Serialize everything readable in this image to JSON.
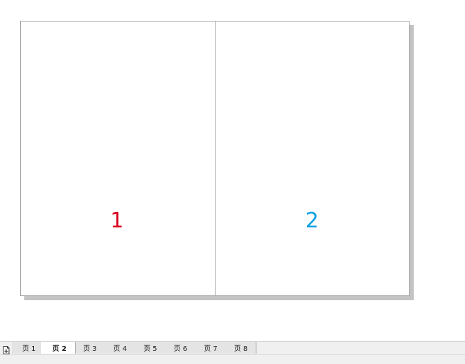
{
  "document": {
    "pages": [
      {
        "label": "1",
        "color": "#d9001b"
      },
      {
        "label": "2",
        "color": "#0ea0e4"
      }
    ]
  },
  "tabbar": {
    "add_icon": "add-page-icon",
    "tabs": [
      {
        "label": "页 1",
        "active": false
      },
      {
        "label": "页 2",
        "active": true
      },
      {
        "label": "页 3",
        "active": false
      },
      {
        "label": "页 4",
        "active": false
      },
      {
        "label": "页 5",
        "active": false
      },
      {
        "label": "页 6",
        "active": false
      },
      {
        "label": "页 7",
        "active": false
      },
      {
        "label": "页 8",
        "active": false
      }
    ]
  }
}
